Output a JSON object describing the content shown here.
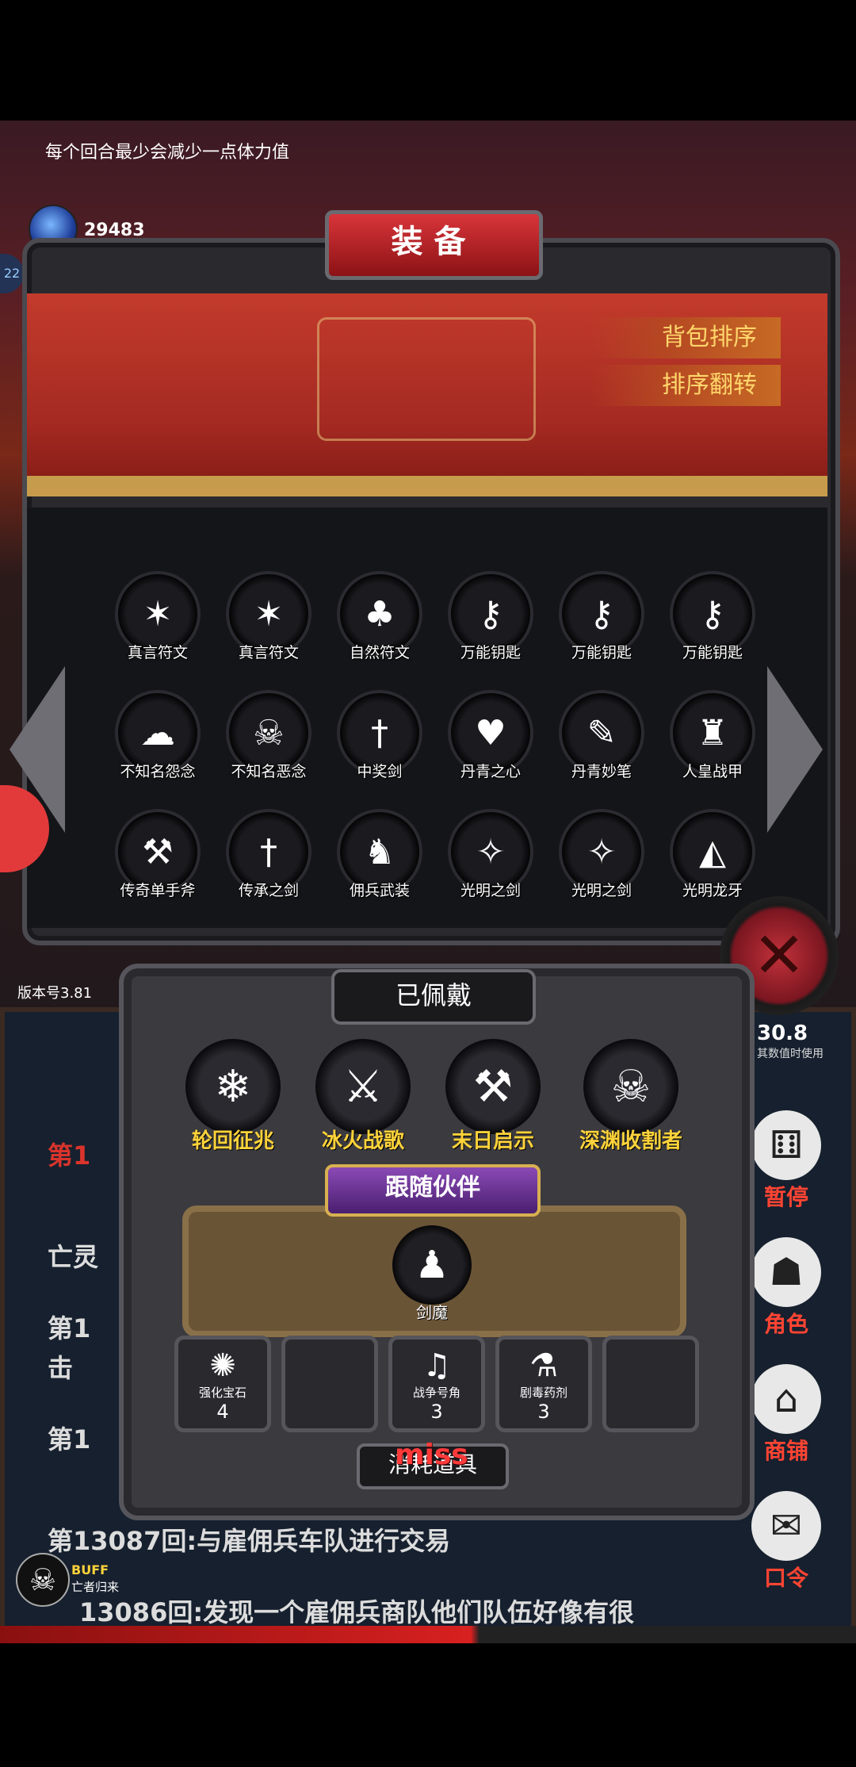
{
  "hint_text": "每个回合最少会减少一点体力值",
  "gem": {
    "count": "29483",
    "label": "宝石"
  },
  "left_badge": "22",
  "equipment": {
    "title": "装备",
    "sort_label": "背包排序",
    "reverse_label": "排序翻转",
    "items": [
      {
        "label": "真言符文",
        "icon": "red-rune-icon",
        "glyph": "✶"
      },
      {
        "label": "真言符文",
        "icon": "red-rune-icon",
        "glyph": "✶"
      },
      {
        "label": "自然符文",
        "icon": "nature-rune-icon",
        "glyph": "♣"
      },
      {
        "label": "万能钥匙",
        "icon": "key-icon",
        "glyph": "⚷"
      },
      {
        "label": "万能钥匙",
        "icon": "key-icon",
        "glyph": "⚷"
      },
      {
        "label": "万能钥匙",
        "icon": "key-icon",
        "glyph": "⚷"
      },
      {
        "label": "不知名怨念",
        "icon": "ghost-icon",
        "glyph": "☁"
      },
      {
        "label": "不知名恶念",
        "icon": "specter-icon",
        "glyph": "☠"
      },
      {
        "label": "中奖剑",
        "icon": "sword-icon",
        "glyph": "†"
      },
      {
        "label": "丹青之心",
        "icon": "heart-icon",
        "glyph": "♥"
      },
      {
        "label": "丹青妙笔",
        "icon": "brush-icon",
        "glyph": "✎"
      },
      {
        "label": "人皇战甲",
        "icon": "armor-icon",
        "glyph": "♜"
      },
      {
        "label": "传奇单手斧",
        "icon": "axe-icon",
        "glyph": "⚒"
      },
      {
        "label": "传承之剑",
        "icon": "sword-icon",
        "glyph": "†"
      },
      {
        "label": "佣兵武装",
        "icon": "knight-icon",
        "glyph": "♞"
      },
      {
        "label": "光明之剑",
        "icon": "light-sword-icon",
        "glyph": "✧"
      },
      {
        "label": "光明之剑",
        "icon": "light-sword-icon",
        "glyph": "✧"
      },
      {
        "label": "光明龙牙",
        "icon": "fang-icon",
        "glyph": "◭"
      }
    ]
  },
  "version": "版本号3.81",
  "score": {
    "value": "30.8",
    "note": "其数值时使用"
  },
  "equipped": {
    "title": "已佩戴",
    "items": [
      {
        "label": "轮回征兆",
        "icon": "ice-staff-icon",
        "glyph": "❄"
      },
      {
        "label": "冰火战歌",
        "icon": "crossed-swords-icon",
        "glyph": "⚔"
      },
      {
        "label": "末日启示",
        "icon": "axes-icon",
        "glyph": "⚒"
      },
      {
        "label": "深渊收割者",
        "icon": "reaper-icon",
        "glyph": "☠"
      }
    ]
  },
  "companion": {
    "title": "跟随伙伴",
    "name": "剑魔",
    "icon": "sword-demon-icon",
    "glyph": "♟"
  },
  "consumables": {
    "title": "消耗道具",
    "items": [
      {
        "label": "强化宝石",
        "count": "4",
        "icon": "green-gem-icon",
        "glyph": "✺"
      },
      {
        "label": "",
        "count": "",
        "icon": "",
        "glyph": ""
      },
      {
        "label": "战争号角",
        "count": "3",
        "icon": "horn-icon",
        "glyph": "♫"
      },
      {
        "label": "剧毒药剂",
        "count": "3",
        "icon": "potion-icon",
        "glyph": "⚗"
      },
      {
        "label": "",
        "count": "",
        "icon": "",
        "glyph": ""
      }
    ]
  },
  "miss_text": "miss",
  "log": {
    "line_a": "第1",
    "line_b": "亡灵",
    "line_c": "第1",
    "line_c2": "击",
    "line_d": "第1",
    "line_e": "第13087回:与雇佣兵车队进行交易",
    "line_f": "13086回:发现一个雇佣兵商队他们队伍好像有很"
  },
  "right_menu": [
    {
      "label": "暂停",
      "icon": "dice-icon",
      "glyph": "⚅"
    },
    {
      "label": "角色",
      "icon": "hood-icon",
      "glyph": "☗"
    },
    {
      "label": "商铺",
      "icon": "shop-icon",
      "glyph": "⌂"
    },
    {
      "label": "口令",
      "icon": "scroll-icon",
      "glyph": "✉"
    }
  ],
  "buff": {
    "label": "BUFF",
    "name": "亡者归来"
  },
  "colors": {
    "accent_red": "#c33b2c",
    "gold": "#ffd33a",
    "panel": "#2a2a2e"
  }
}
